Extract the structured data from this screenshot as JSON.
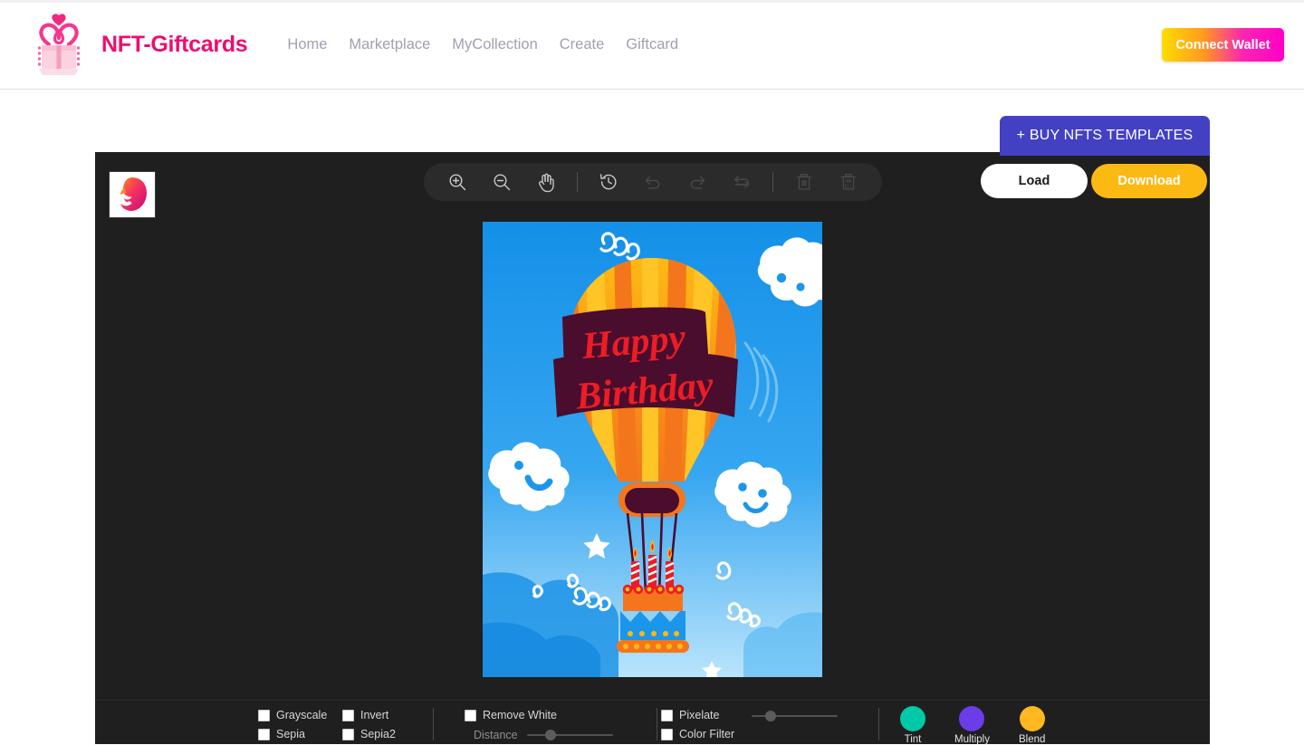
{
  "header": {
    "brand_name": "NFT-Giftcards",
    "logo_icon": "gift-box-heart-icon",
    "nav": [
      {
        "label": "Home"
      },
      {
        "label": "Marketplace"
      },
      {
        "label": "MyCollection"
      },
      {
        "label": "Create"
      },
      {
        "label": "Giftcard"
      }
    ],
    "connect_wallet_label": "Connect Wallet",
    "connect_wallet_gradient_from": "#ffdd00",
    "connect_wallet_gradient_to": "#ff00c8",
    "brand_color": "#ef0d6e"
  },
  "buy_templates": {
    "label": "+ BUY NFTS TEMPLATES",
    "color": "#4340c4"
  },
  "editor": {
    "background": "#1f1f1f",
    "thumbnails": [
      {
        "name": "lion-gradient-thumbnail",
        "alt": "colorful lion head"
      }
    ],
    "toolbar": [
      {
        "icon": "zoom-in-icon",
        "name": "zoom-in",
        "enabled": true
      },
      {
        "icon": "zoom-out-icon",
        "name": "zoom-out",
        "enabled": true
      },
      {
        "icon": "pan-hand-icon",
        "name": "pan",
        "enabled": true
      },
      {
        "icon": "separator",
        "name": "separator-1",
        "enabled": false
      },
      {
        "icon": "history-reset-icon",
        "name": "reset-history",
        "enabled": true
      },
      {
        "icon": "undo-icon",
        "name": "undo",
        "enabled": false
      },
      {
        "icon": "redo-icon",
        "name": "redo",
        "enabled": false
      },
      {
        "icon": "reload-swap-icon",
        "name": "reload",
        "enabled": false
      },
      {
        "icon": "separator",
        "name": "separator-2",
        "enabled": false
      },
      {
        "icon": "trash-icon",
        "name": "delete",
        "enabled": false
      },
      {
        "icon": "trash-all-icon",
        "name": "delete-all",
        "enabled": false
      }
    ],
    "load_label": "Load",
    "download_label": "Download",
    "download_color": "#fdb913"
  },
  "artwork": {
    "title": "Happy Birthday hot air balloon greeting card",
    "text_line_1": "Happy",
    "text_line_2": "Birthday",
    "sky_color": "#1794e8",
    "balloon_primary": "#f6871f",
    "balloon_secondary": "#ffc425",
    "banner_color": "#4a0d2e",
    "text_color": "#ee1c25"
  },
  "controls": {
    "filters": [
      {
        "label": "Grayscale",
        "checked": false
      },
      {
        "label": "Invert",
        "checked": false
      },
      {
        "label": "Sepia",
        "checked": false
      },
      {
        "label": "Sepia2",
        "checked": false
      }
    ],
    "remove_white": {
      "label": "Remove White",
      "checked": false
    },
    "distance": {
      "label": "Distance",
      "value_percent": 25
    },
    "pixelate": {
      "label": "Pixelate",
      "checked": false,
      "value_percent": 18
    },
    "color_filter": {
      "label": "Color Filter",
      "checked": false
    },
    "blend_modes": [
      {
        "label": "Tint",
        "color": "#00c9a7"
      },
      {
        "label": "Multiply",
        "color": "#6a3de8"
      },
      {
        "label": "Blend",
        "color": "#ffb81f"
      }
    ]
  }
}
